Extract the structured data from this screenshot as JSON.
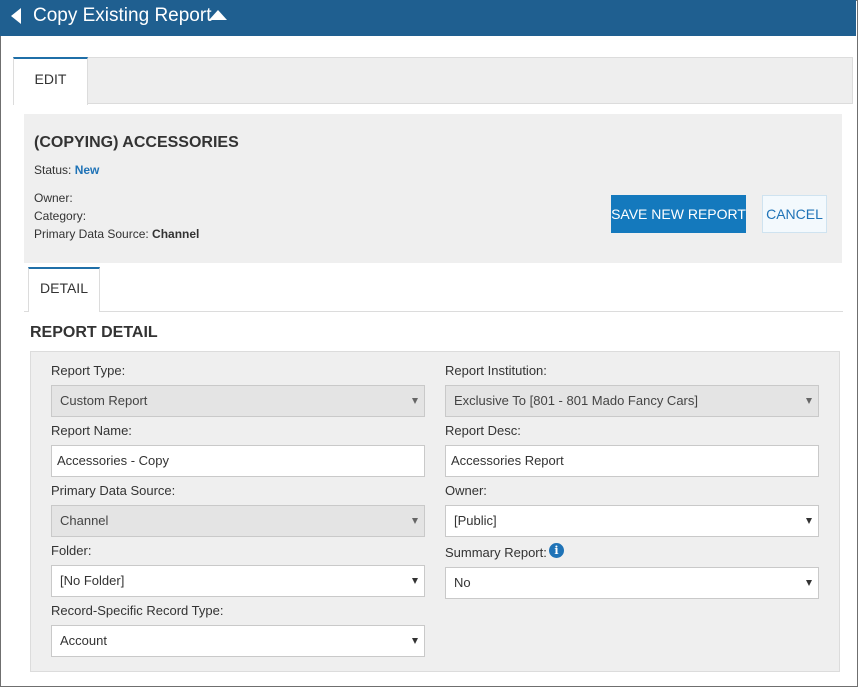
{
  "header": {
    "title": "Copy Existing Report"
  },
  "tabs": {
    "edit": "EDIT",
    "detail": "DETAIL"
  },
  "summary": {
    "title": "(COPYING) ACCESSORIES",
    "status_label": "Status:",
    "status_value": "New",
    "owner_label": "Owner:",
    "category_label": "Category:",
    "primary_source_label": "Primary Data Source:",
    "primary_source_value": "Channel"
  },
  "buttons": {
    "save": "SAVE NEW REPORT",
    "cancel": "CANCEL"
  },
  "section": {
    "title": "REPORT DETAIL"
  },
  "form": {
    "report_type": {
      "label": "Report Type:",
      "value": "Custom Report"
    },
    "report_institution": {
      "label": "Report Institution:",
      "value": "Exclusive To [801 - 801 Mado Fancy Cars]"
    },
    "report_name": {
      "label": "Report Name:",
      "value": "Accessories - Copy"
    },
    "report_desc": {
      "label": "Report Desc:",
      "value": "Accessories Report"
    },
    "primary_data_source": {
      "label": "Primary Data Source:",
      "value": "Channel"
    },
    "owner": {
      "label": "Owner:",
      "value": "[Public]"
    },
    "folder": {
      "label": "Folder:",
      "value": "[No Folder]"
    },
    "summary_report": {
      "label": "Summary Report:",
      "value": "No"
    },
    "record_type": {
      "label": "Record-Specific Record Type:",
      "value": "Account"
    }
  },
  "icons": {
    "back": "chevron-left-icon",
    "collapse": "caret-up-icon",
    "info": "info-icon",
    "dropdown": "caret-down-icon"
  },
  "colors": {
    "header_bg": "#1f5f90",
    "accent": "#1479bd",
    "status": "#1f73b7"
  }
}
